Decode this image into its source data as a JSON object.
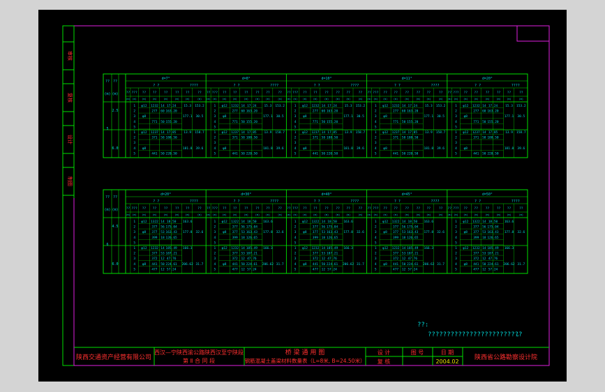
{
  "side_stamps": [
    "审核",
    "复核",
    "设计",
    "制图"
  ],
  "tables": [
    {
      "groups": [
        "d=7°",
        "d=8°",
        "d=10°",
        "d=11°",
        "d=20°"
      ],
      "group_cols": [
        [
          "? ?",
          "????"
        ],
        [
          "? ?",
          "????"
        ],
        [
          "? ?",
          "????"
        ],
        [
          "? ?",
          "????"
        ],
        [
          "? ?",
          "????"
        ]
      ],
      "left_headers": [
        "??",
        "??",
        "(m)",
        "(m)"
      ],
      "rows_a": [
        [
          "1",
          "φ12",
          "1232",
          "14",
          "17.24",
          "15.3",
          "153.2"
        ],
        [
          "2",
          "",
          "277",
          "60",
          "163.20",
          "",
          ""
        ],
        [
          "3",
          "φ8",
          "",
          "",
          "",
          "177.1",
          "30.5"
        ],
        [
          "4",
          "",
          "771",
          "50",
          "155.20",
          "",
          ""
        ],
        [
          "5",
          "",
          "",
          "",
          "",
          "",
          ""
        ]
      ],
      "rows_b": [
        [
          "1",
          "φ12",
          "1237",
          "14",
          "17.85",
          "13.9",
          "158.7"
        ],
        [
          "2",
          "",
          "371",
          "58",
          "188.50",
          "",
          ""
        ],
        [
          "3",
          "",
          "",
          "",
          "",
          "",
          ""
        ],
        [
          "4",
          "φ8",
          "",
          "",
          "",
          "181.8",
          "39.6"
        ],
        [
          "5",
          "",
          "441",
          "50",
          "220.50",
          "",
          ""
        ]
      ],
      "span_labels": [
        "2.5",
        "5",
        "6.0"
      ]
    },
    {
      "groups": [
        "d=20°",
        "d=30°",
        "d=40°",
        "d=45°",
        "d=50°"
      ],
      "group_cols": [
        [
          "? ?",
          "????"
        ],
        [
          "? ?",
          "????"
        ],
        [
          "? ?",
          "????"
        ],
        [
          "? ?",
          "????"
        ],
        [
          "? ?",
          "????"
        ]
      ],
      "left_headers": [
        "??",
        "??",
        "(m)",
        "(m)"
      ],
      "rows_a": [
        [
          "1",
          "φ12",
          "1322",
          "14",
          "18.50",
          "163.6",
          ""
        ],
        [
          "2",
          "",
          "377",
          "56",
          "175.04",
          "",
          ""
        ],
        [
          "3",
          "φ8",
          "377",
          "53",
          "163.43",
          "177.8",
          "32.6"
        ],
        [
          "4",
          "",
          "399",
          "18",
          "126.65",
          "",
          ""
        ],
        [
          "5",
          "",
          "",
          "",
          "",
          "",
          ""
        ]
      ],
      "rows_b": [
        [
          "1",
          "φ12",
          "1232",
          "14",
          "185.49",
          "166.3",
          ""
        ],
        [
          "2",
          "",
          "377",
          "53",
          "187.21",
          "",
          ""
        ],
        [
          "3",
          "",
          "372",
          "12",
          "47.76",
          "",
          ""
        ],
        [
          "4",
          "φ8",
          "441",
          "50",
          "224.61",
          "206.62",
          "31.7"
        ],
        [
          "5",
          "",
          "477",
          "12",
          "57.24",
          "",
          ""
        ]
      ],
      "span_labels": [
        "4.5",
        "6",
        "6.0"
      ]
    }
  ],
  "note": {
    "label": "??:",
    "text": "?????????????????????????",
    "period": "。"
  },
  "title_block": {
    "company": "陕西交通资产经营有限公司",
    "project_line1": "西汉—宁陕西渝公路陕西汉至宁陕段",
    "project_line2": "第 Ⅱ 合 同 段",
    "drawing_title1": "桥 梁 通 用 图",
    "drawing_title2": "钢筋混凝土盖梁材料数量表（L=8米, B=24.50米）",
    "design_label": "设 计",
    "drawing_no_label": "图 号",
    "date_label": "日 期",
    "review_label": "复 核",
    "date_value": "2004.02",
    "institute": "陕西省公路勘察设计院"
  }
}
